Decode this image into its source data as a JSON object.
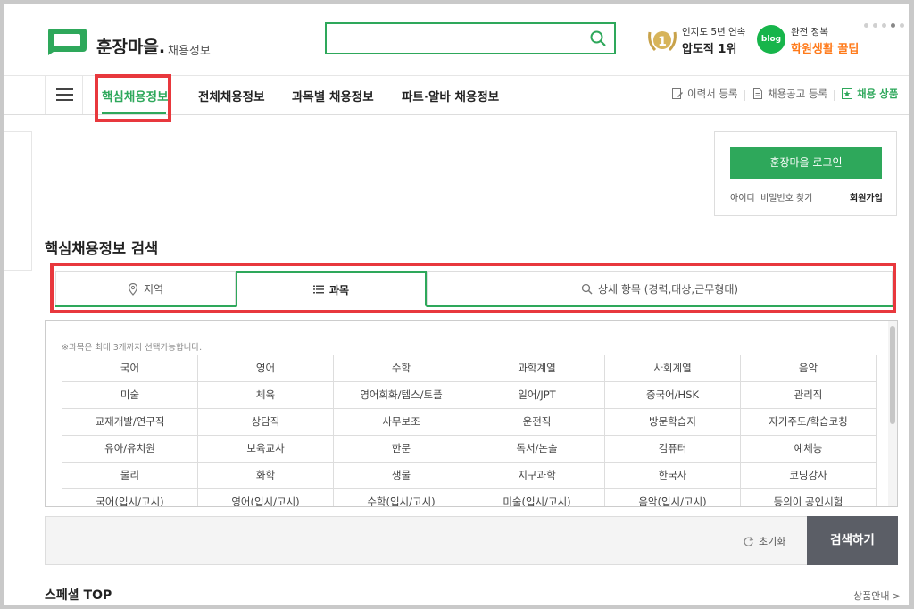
{
  "header": {
    "logo_text": "훈장마을.",
    "logo_sub": "채용정보",
    "search_placeholder": "",
    "award_line1": "인지도 5년 연속",
    "award_line2": "압도적 1위",
    "award_badge": "1",
    "blog_badge": "blog",
    "blog_line1": "완전 정복",
    "blog_line2": "학원생활 꿀팁",
    "colors": {
      "brand": "#2ea85b",
      "highlight": "#e8383d",
      "orange": "#ff7a1a"
    }
  },
  "nav": {
    "items": [
      {
        "label": "핵심채용정보"
      },
      {
        "label": "전체채용정보"
      },
      {
        "label": "과목별 채용정보"
      },
      {
        "label": "파트·알바 채용정보"
      }
    ],
    "util": [
      {
        "label": "이력서 등록",
        "icon": "edit-icon"
      },
      {
        "label": "채용공고 등록",
        "icon": "document-icon"
      },
      {
        "label": "채용 상품",
        "icon": "star-icon"
      }
    ]
  },
  "login": {
    "button": "훈장마을 로그인",
    "id_link": "아이디",
    "pw_link": "비밀번호 찾기",
    "join_link": "회원가입"
  },
  "search_section": {
    "title": "핵심채용정보 검색",
    "tabs": [
      {
        "label": "지역",
        "icon": "location-pin-icon"
      },
      {
        "label": "과목",
        "icon": "list-icon"
      },
      {
        "label": "상세 항목 (경력,대상,근무형태)",
        "icon": "magnifier-icon"
      }
    ],
    "note": "※과목은 최대 3개까지 선택가능합니다.",
    "subjects": [
      [
        "국어",
        "영어",
        "수학",
        "과학계열",
        "사회계열",
        "음악"
      ],
      [
        "미술",
        "체육",
        "영어회화/텝스/토플",
        "일어/JPT",
        "중국어/HSK",
        "관리직"
      ],
      [
        "교재개발/연구직",
        "상담직",
        "사무보조",
        "운전직",
        "방문학습지",
        "자기주도/학습코칭"
      ],
      [
        "유아/유치원",
        "보육교사",
        "한문",
        "독서/논술",
        "컴퓨터",
        "예체능"
      ],
      [
        "물리",
        "화학",
        "생물",
        "지구과학",
        "한국사",
        "코딩강사"
      ],
      [
        "국어(입시/고시)",
        "영어(입시/고시)",
        "수학(입시/고시)",
        "미술(입시/고시)",
        "음악(입시/고시)",
        "등의이 공인시험"
      ]
    ],
    "reset": "초기화",
    "search_button": "검색하기"
  },
  "special": {
    "title": "스페셜 TOP",
    "guide": "상품안내 >"
  }
}
